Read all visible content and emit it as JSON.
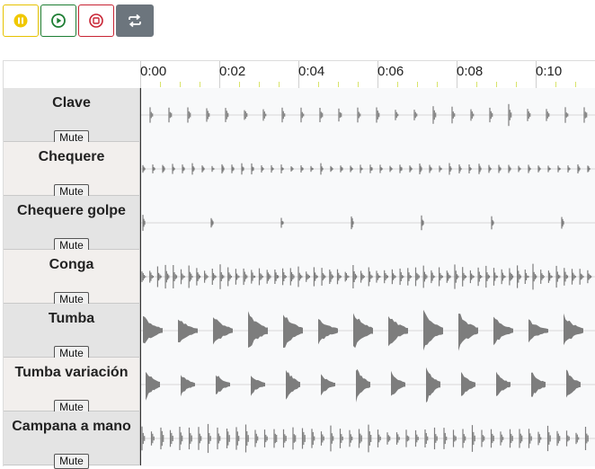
{
  "toolbar": {
    "buttons": [
      {
        "name": "pause-button",
        "icon": "pause-icon",
        "color": "#e6c200"
      },
      {
        "name": "play-button",
        "icon": "play-icon",
        "color": "#1e7e34"
      },
      {
        "name": "stop-button",
        "icon": "stop-icon",
        "color": "#c82333"
      },
      {
        "name": "loop-button",
        "icon": "loop-icon",
        "color": "#6c757d"
      }
    ]
  },
  "timescale": {
    "labels": [
      "0:00",
      "0:02",
      "0:04",
      "0:06",
      "0:08",
      "0:10"
    ]
  },
  "mute_label": "Mute",
  "tracks": [
    {
      "name": "Clave",
      "pattern": "clave"
    },
    {
      "name": "Chequere",
      "pattern": "chequere"
    },
    {
      "name": "Chequere golpe",
      "pattern": "golpe"
    },
    {
      "name": "Conga",
      "pattern": "conga"
    },
    {
      "name": "Tumba",
      "pattern": "tumba"
    },
    {
      "name": "Tumba variación",
      "pattern": "tumbavar"
    },
    {
      "name": "Campana a mano",
      "pattern": "campana"
    }
  ],
  "colors": {
    "waveform": "#7d7d7d",
    "cursor": "#333333",
    "minor_tick": "#d8e36a"
  }
}
